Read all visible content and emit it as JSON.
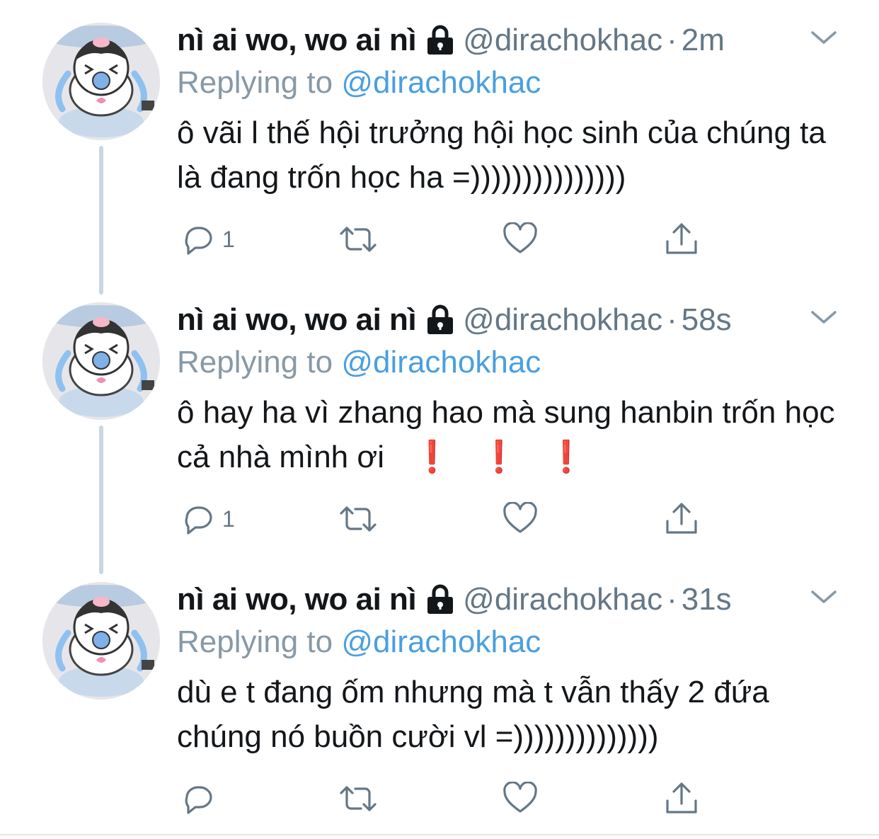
{
  "tweets": [
    {
      "name": "nì ai wo, wo ai nì",
      "handle": "@dirachokhac",
      "separator": "·",
      "time": "2m",
      "replying_label": "Replying to",
      "replying_to": "@dirachokhac",
      "text": "ô vãi l thế hội trưởng hội học sinh của chúng ta là đang trốn học ha =)))))))))))))))",
      "reply_count": "1"
    },
    {
      "name": "nì ai wo, wo ai nì",
      "handle": "@dirachokhac",
      "separator": "·",
      "time": "58s",
      "replying_label": "Replying to",
      "replying_to": "@dirachokhac",
      "text": "ô hay ha vì zhang hao mà sung hanbin trốn học cả nhà mình ơi",
      "text_emoji": [
        "❗",
        "❗",
        "❗"
      ],
      "reply_count": "1"
    },
    {
      "name": "nì ai wo, wo ai nì",
      "handle": "@dirachokhac",
      "separator": "·",
      "time": "31s",
      "replying_label": "Replying to",
      "replying_to": "@dirachokhac",
      "text": "dù e t đang ốm nhưng mà t vẫn thấy 2 đứa chúng nó buồn cười vl =))))))))))))))",
      "reply_count": ""
    }
  ],
  "icons": {
    "lock": "lock-icon",
    "caret": "chevron-down-icon",
    "reply": "reply-icon",
    "retweet": "retweet-icon",
    "like": "heart-icon",
    "share": "share-icon"
  },
  "colors": {
    "name": "#14171a",
    "secondary": "#657786",
    "replying_label": "#8899a6",
    "mention": "#4a9fe0",
    "thread_line": "#c9d7e3",
    "exclamation": "#dd2e44"
  }
}
